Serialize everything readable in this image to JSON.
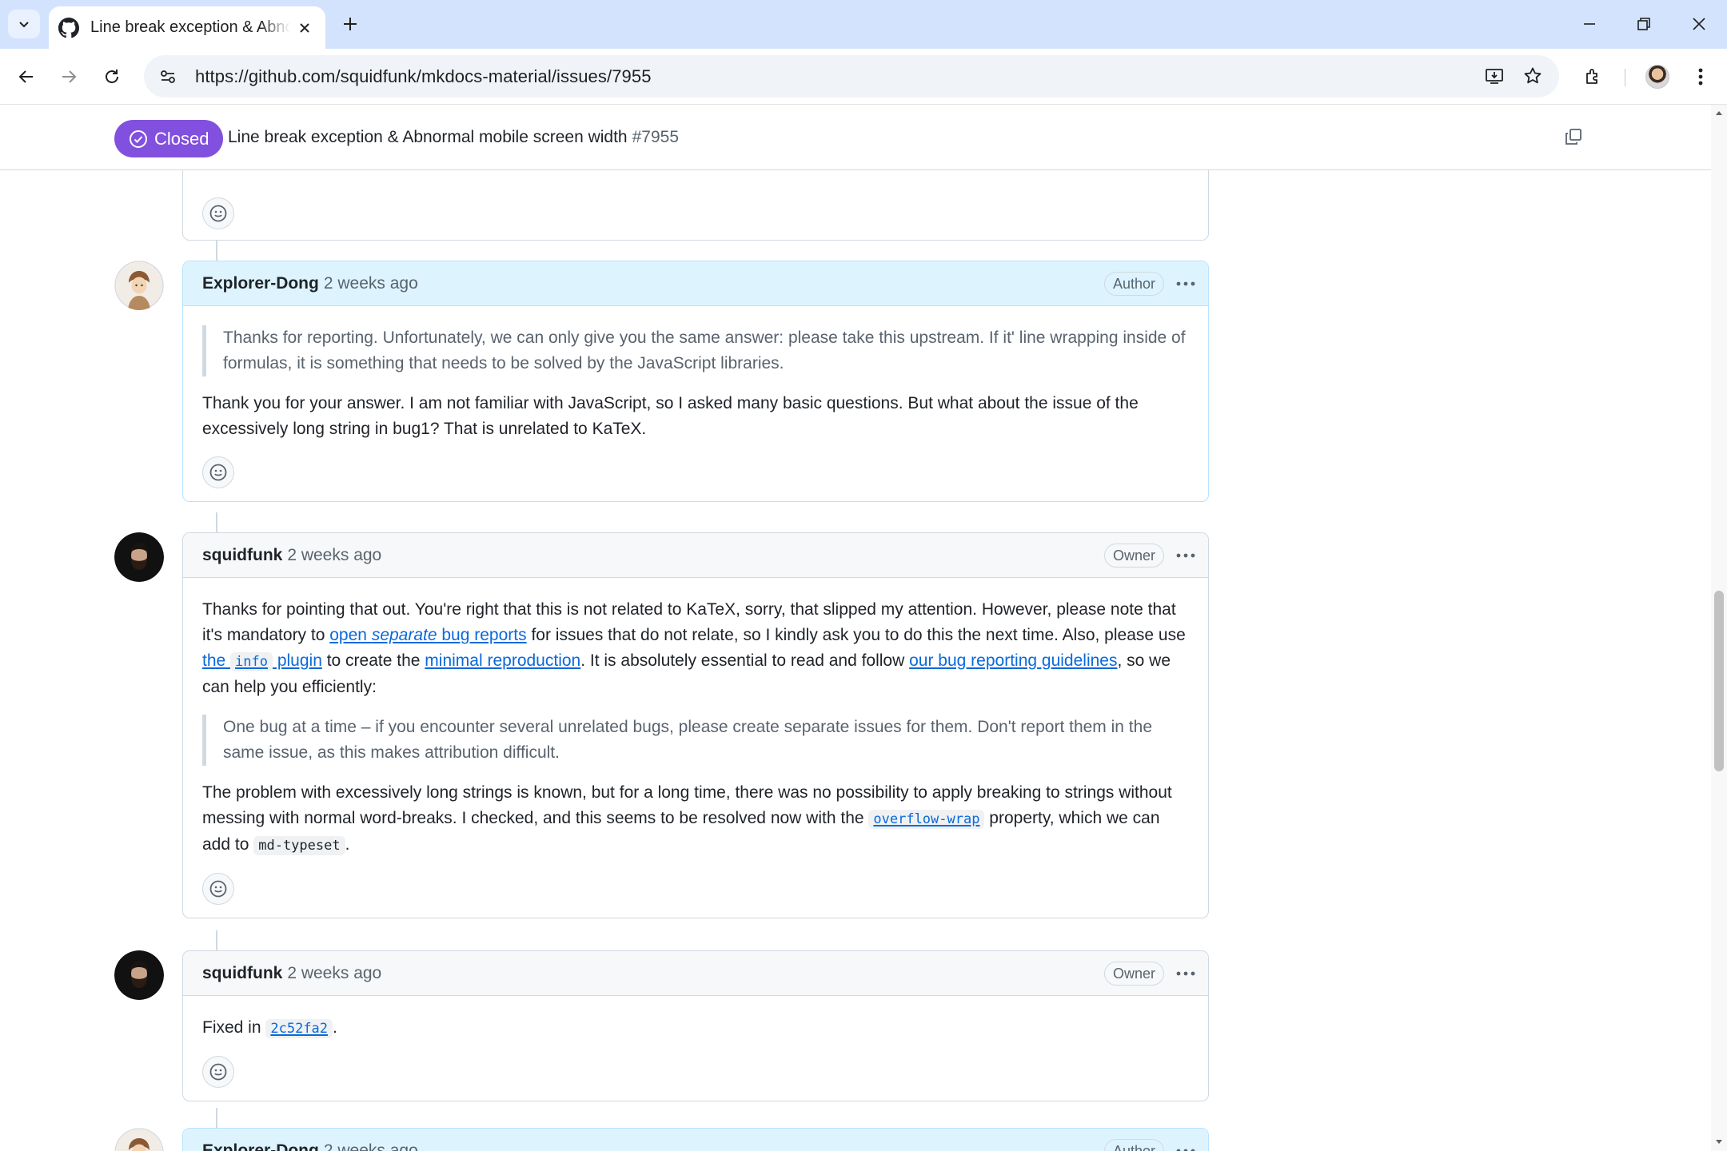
{
  "browser": {
    "tab_title": "Line break exception & Abnormal mobile screen width",
    "url": "https://github.com/squidfunk/mkdocs-material/issues/7955"
  },
  "issue": {
    "state": "Closed",
    "title": "Line break exception & Abnormal mobile screen width",
    "number": "#7955"
  },
  "comments": [
    {
      "author": "Explorer-Dong",
      "time": "2 weeks ago",
      "role": "Author",
      "quote": "Thanks for reporting. Unfortunately, we can only give you the same answer: please take this upstream. If it' line wrapping inside of formulas, it is something that needs to be solved by the JavaScript libraries.",
      "text": "Thank you for your answer. I am not familiar with JavaScript, so I asked many basic questions. But what about the issue of the excessively long string in bug1? That is unrelated to KaTeX."
    },
    {
      "author": "squidfunk",
      "time": "2 weeks ago",
      "role": "Owner",
      "p1": {
        "t1": "Thanks for pointing that out. You're right that this is not related to KaTeX, sorry, that slipped my attention. However, please note that it's mandatory to ",
        "link1a": "open ",
        "link1b": "separate",
        "link1c": " bug reports",
        "t2": " for issues that do not relate, so I kindly ask you to do this the next time. Also, please use ",
        "link2a": "the ",
        "link2code": "info",
        "link2b": " plugin",
        "t3": " to create the ",
        "link3": "minimal reproduction",
        "t4": ". It is absolutely essential to read and follow ",
        "link4": "our bug reporting guidelines",
        "t5": ", so we can help you efficiently:"
      },
      "quote": "One bug at a time – if you encounter several unrelated bugs, please create separate issues for them. Don't report them in the same issue, as this makes attribution difficult.",
      "p2": {
        "t1": "The problem with excessively long strings is known, but for a long time, there was no possibility to apply breaking to strings without messing with normal word-breaks. I checked, and this seems to be resolved now with the ",
        "code1": "overflow-wrap",
        "t2": " property, which we can add to ",
        "code2": "md-typeset",
        "t3": "."
      }
    },
    {
      "author": "squidfunk",
      "time": "2 weeks ago",
      "role": "Owner",
      "t1": "Fixed in ",
      "commit": "2c52fa2",
      "t2": "."
    },
    {
      "author": "Explorer-Dong",
      "time": "2 weeks ago",
      "role": "Author"
    }
  ],
  "colors": {
    "closed_purple": "#8250df",
    "link_blue": "#0969da",
    "author_highlight": "#ddf4ff",
    "tabbar": "#d3e3fd"
  }
}
